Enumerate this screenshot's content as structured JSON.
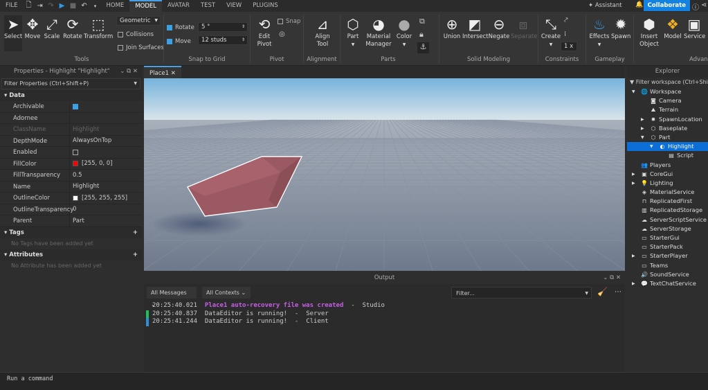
{
  "menubar": {
    "file": "FILE",
    "tabs": [
      "HOME",
      "MODEL",
      "AVATAR",
      "TEST",
      "VIEW",
      "PLUGINS"
    ],
    "active_tab": "MODEL",
    "assistant": "Assistant",
    "collaborate": "Collaborate"
  },
  "ribbon": {
    "tools": [
      {
        "label": "Select",
        "icon": "➤"
      },
      {
        "label": "Move",
        "icon": "✥"
      },
      {
        "label": "Scale",
        "icon": "⤢"
      },
      {
        "label": "Rotate",
        "icon": "⟳"
      },
      {
        "label": "Transform",
        "icon": "⬚"
      }
    ],
    "mode": "Geometric",
    "collisions": "Collisions",
    "join_surfaces": "Join Surfaces",
    "rotate_label": "Rotate",
    "rotate_value": "5 °",
    "move_label": "Move",
    "move_value": "12 studs",
    "edit_pivot": "Edit Pivot",
    "snap": "Snap",
    "align_tool": "Align Tool",
    "part": "Part",
    "material_manager": "Material Manager",
    "color": "Color",
    "union": "Union",
    "intersect": "Intersect",
    "negate": "Negate",
    "separate": "Separate",
    "create": "Create",
    "constraint_scale": "1 x",
    "effects": "Effects",
    "spawn": "Spawn",
    "insert_object": "Insert Object",
    "model": "Model",
    "service": "Service",
    "groups": [
      "Tools",
      "Snap to Grid",
      "Pivot",
      "Alignment",
      "Parts",
      "Solid Modeling",
      "Constraints",
      "Gameplay",
      "Advanced"
    ]
  },
  "properties": {
    "title": "Properties - Highlight \"Highlight\"",
    "filter": "Filter Properties (Ctrl+Shift+P)",
    "section_data": "Data",
    "rows": [
      {
        "k": "Archivable",
        "v": "",
        "type": "check_on"
      },
      {
        "k": "Adornee",
        "v": ""
      },
      {
        "k": "ClassName",
        "v": "Highlight",
        "dim": true
      },
      {
        "k": "DepthMode",
        "v": "AlwaysOnTop"
      },
      {
        "k": "Enabled",
        "v": "",
        "type": "check_off"
      },
      {
        "k": "FillColor",
        "v": "[255, 0, 0]",
        "swatch": "#ff0000"
      },
      {
        "k": "FillTransparency",
        "v": "0.5"
      },
      {
        "k": "Name",
        "v": "Highlight"
      },
      {
        "k": "OutlineColor",
        "v": "[255, 255, 255]",
        "swatch": "#ffffff"
      },
      {
        "k": "OutlineTransparency",
        "v": "0"
      },
      {
        "k": "Parent",
        "v": "Part"
      }
    ],
    "tags": "Tags",
    "tags_empty": "No Tags have been added yet",
    "attributes": "Attributes",
    "attributes_empty": "No Attribute has been added yet"
  },
  "viewport": {
    "tab": "Place1"
  },
  "output": {
    "title": "Output",
    "messages_filter": "All Messages",
    "contexts_filter": "All Contexts",
    "filter_placeholder": "Filter...",
    "logs": [
      {
        "time": "20:25:40.021",
        "msg": "Place1 auto-recovery file was created",
        "src": "Studio",
        "color": "#c65ee6",
        "bar": ""
      },
      {
        "time": "20:25:40.837",
        "msg": "DataEditor is running!",
        "src": "Server",
        "color": "#cccccc",
        "bar": "#1fbf5a"
      },
      {
        "time": "20:25:41.244",
        "msg": "DataEditor is running!",
        "src": "Client",
        "color": "#cccccc",
        "bar": "#2f8fd8"
      }
    ]
  },
  "command": {
    "placeholder": "Run a command"
  },
  "explorer": {
    "title": "Explorer",
    "filter": "Filter workspace (Ctrl+Shift",
    "items": [
      {
        "label": "Workspace",
        "lvl": 0,
        "arrow": "open",
        "icon": "🌐"
      },
      {
        "label": "Camera",
        "lvl": 1,
        "icon": "◙"
      },
      {
        "label": "Terrain",
        "lvl": 1,
        "icon": "⛰"
      },
      {
        "label": "SpawnLocation",
        "lvl": 1,
        "arrow": "closed",
        "icon": "✹"
      },
      {
        "label": "Baseplate",
        "lvl": 1,
        "arrow": "closed",
        "icon": "⬡"
      },
      {
        "label": "Part",
        "lvl": 1,
        "arrow": "open",
        "icon": "⬡"
      },
      {
        "label": "Highlight",
        "lvl": 2,
        "arrow": "open",
        "icon": "◐",
        "sel": true
      },
      {
        "label": "Script",
        "lvl": 3,
        "icon": "▤"
      },
      {
        "label": "Players",
        "lvl": 0,
        "icon": "👥"
      },
      {
        "label": "CoreGui",
        "lvl": 0,
        "arrow": "closed",
        "icon": "▣"
      },
      {
        "label": "Lighting",
        "lvl": 0,
        "arrow": "closed",
        "icon": "💡"
      },
      {
        "label": "MaterialService",
        "lvl": 0,
        "icon": "◈"
      },
      {
        "label": "ReplicatedFirst",
        "lvl": 0,
        "icon": "⊓"
      },
      {
        "label": "ReplicatedStorage",
        "lvl": 0,
        "icon": "▥"
      },
      {
        "label": "ServerScriptService",
        "lvl": 0,
        "icon": "☁"
      },
      {
        "label": "ServerStorage",
        "lvl": 0,
        "icon": "☁"
      },
      {
        "label": "StarterGui",
        "lvl": 0,
        "icon": "▭"
      },
      {
        "label": "StarterPack",
        "lvl": 0,
        "icon": "▭"
      },
      {
        "label": "StarterPlayer",
        "lvl": 0,
        "arrow": "closed",
        "icon": "▭"
      },
      {
        "label": "Teams",
        "lvl": 0,
        "icon": "▭"
      },
      {
        "label": "SoundService",
        "lvl": 0,
        "icon": "🔊"
      },
      {
        "label": "TextChatService",
        "lvl": 0,
        "arrow": "closed",
        "icon": "💬"
      }
    ]
  }
}
